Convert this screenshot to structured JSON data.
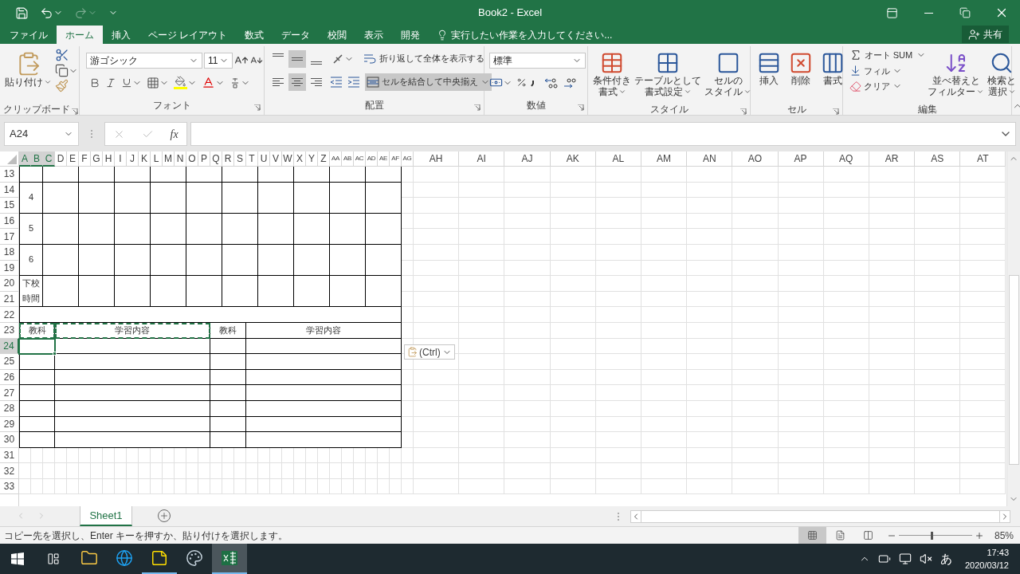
{
  "window": {
    "title": "Book2 - Excel"
  },
  "ribbon_tabs": [
    {
      "label": "ファイル",
      "selected": false
    },
    {
      "label": "ホーム",
      "selected": true
    },
    {
      "label": "挿入",
      "selected": false
    },
    {
      "label": "ページ レイアウト",
      "selected": false
    },
    {
      "label": "数式",
      "selected": false
    },
    {
      "label": "データ",
      "selected": false
    },
    {
      "label": "校閲",
      "selected": false
    },
    {
      "label": "表示",
      "selected": false
    },
    {
      "label": "開発",
      "selected": false
    }
  ],
  "tell_me": {
    "placeholder": "実行したい作業を入力してください..."
  },
  "share_button": "共有",
  "clipboard": {
    "paste_button": "貼り付け",
    "group_label": "クリップボード"
  },
  "font": {
    "name": "游ゴシック",
    "size": "11",
    "group_label": "フォント"
  },
  "alignment": {
    "vertical": [
      {
        "selected": false
      },
      {
        "selected": true
      },
      {
        "selected": false
      }
    ],
    "horizontal": [
      {
        "selected": false
      },
      {
        "selected": true
      },
      {
        "selected": false
      }
    ],
    "wrap_button": {
      "label": "折り返して全体を表示する",
      "selected": false
    },
    "merge_button": {
      "label": "セルを結合して中央揃え",
      "selected": true
    },
    "group_label": "配置"
  },
  "number": {
    "format": "標準",
    "group_label": "数値"
  },
  "styles": {
    "buttons": [
      {
        "lines": [
          "条件付き",
          "書式"
        ]
      },
      {
        "lines": [
          "テーブルとして",
          "書式設定"
        ]
      },
      {
        "lines": [
          "セルの",
          "スタイル"
        ]
      }
    ],
    "group_label": "スタイル"
  },
  "cells": {
    "buttons": [
      "挿入",
      "削除",
      "書式"
    ],
    "group_label": "セル"
  },
  "editing": {
    "autosum": "オート SUM",
    "fill": "フィル",
    "clear": "クリア",
    "sort_button": {
      "lines": [
        "並べ替えと",
        "フィルター"
      ]
    },
    "find_button": {
      "lines": [
        "検索と",
        "選択"
      ]
    },
    "group_label": "編集"
  },
  "formula_bar": {
    "name_box": "A24",
    "function_label": "fx"
  },
  "sheet": {
    "columns": [
      {
        "label": "A",
        "selected": true
      },
      {
        "label": "B",
        "selected": true
      },
      {
        "label": "C",
        "selected": true
      },
      {
        "label": "D",
        "selected": false
      },
      {
        "label": "E",
        "selected": false
      },
      {
        "label": "F",
        "selected": false
      },
      {
        "label": "G",
        "selected": false
      },
      {
        "label": "H",
        "selected": false
      },
      {
        "label": "I",
        "selected": false
      },
      {
        "label": "J",
        "selected": false
      },
      {
        "label": "K",
        "selected": false
      },
      {
        "label": "L",
        "selected": false
      },
      {
        "label": "M",
        "selected": false
      },
      {
        "label": "N",
        "selected": false
      },
      {
        "label": "O",
        "selected": false
      },
      {
        "label": "P",
        "selected": false
      },
      {
        "label": "Q",
        "selected": false
      },
      {
        "label": "R",
        "selected": false
      },
      {
        "label": "S",
        "selected": false
      },
      {
        "label": "T",
        "selected": false
      },
      {
        "label": "U",
        "selected": false
      },
      {
        "label": "V",
        "selected": false
      },
      {
        "label": "W",
        "selected": false
      },
      {
        "label": "X",
        "selected": false
      },
      {
        "label": "Y",
        "selected": false
      },
      {
        "label": "Z",
        "selected": false
      },
      {
        "label": "AA",
        "selected": false
      },
      {
        "label": "AB",
        "selected": false
      },
      {
        "label": "AC",
        "selected": false
      },
      {
        "label": "AD",
        "selected": false
      },
      {
        "label": "AE",
        "selected": false
      },
      {
        "label": "AF",
        "selected": false
      },
      {
        "label": "AG",
        "selected": false
      },
      {
        "label": "AH",
        "selected": false
      },
      {
        "label": "AI",
        "selected": false
      },
      {
        "label": "AJ",
        "selected": false
      },
      {
        "label": "AK",
        "selected": false
      },
      {
        "label": "AL",
        "selected": false
      },
      {
        "label": "AM",
        "selected": false
      },
      {
        "label": "AN",
        "selected": false
      },
      {
        "label": "AO",
        "selected": false
      },
      {
        "label": "AP",
        "selected": false
      },
      {
        "label": "AQ",
        "selected": false
      },
      {
        "label": "AR",
        "selected": false
      },
      {
        "label": "AS",
        "selected": false
      },
      {
        "label": "AT",
        "selected": false
      }
    ],
    "rows": [
      {
        "label": "13",
        "selected": false
      },
      {
        "label": "14",
        "selected": false
      },
      {
        "label": "15",
        "selected": false
      },
      {
        "label": "16",
        "selected": false
      },
      {
        "label": "17",
        "selected": false
      },
      {
        "label": "18",
        "selected": false
      },
      {
        "label": "19",
        "selected": false
      },
      {
        "label": "20",
        "selected": false
      },
      {
        "label": "21",
        "selected": false
      },
      {
        "label": "22",
        "selected": false
      },
      {
        "label": "23",
        "selected": false
      },
      {
        "label": "24",
        "selected": true
      },
      {
        "label": "25",
        "selected": false
      },
      {
        "label": "26",
        "selected": false
      },
      {
        "label": "27",
        "selected": false
      },
      {
        "label": "28",
        "selected": false
      },
      {
        "label": "29",
        "selected": false
      },
      {
        "label": "30",
        "selected": false
      },
      {
        "label": "31",
        "selected": false
      },
      {
        "label": "32",
        "selected": false
      },
      {
        "label": "33",
        "selected": false
      }
    ],
    "periods": [
      {
        "lines": [
          "4"
        ]
      },
      {
        "lines": [
          "5"
        ]
      },
      {
        "lines": [
          "6"
        ]
      },
      {
        "lines": [
          "下校",
          "時間"
        ]
      }
    ],
    "note_headers": [
      {
        "label": "教科",
        "copied": true
      },
      {
        "label": "学習内容",
        "copied": true
      },
      {
        "label": "教科",
        "copied": false
      },
      {
        "label": "学習内容",
        "copied": false
      }
    ]
  },
  "paste_options": "(Ctrl)",
  "sheet_tabs": [
    {
      "label": "Sheet1",
      "selected": true
    }
  ],
  "status_bar": {
    "message": "コピー先を選択し、Enter キーを押すか、貼り付けを選択します。",
    "views": [
      {
        "selected": true
      },
      {
        "selected": false
      },
      {
        "selected": false
      }
    ],
    "zoom": {
      "level": 0.43,
      "reading": "85%"
    }
  },
  "taskbar": {
    "apps": [
      {
        "kind": "explorer",
        "running": false,
        "selected": false
      },
      {
        "kind": "browser",
        "running": false,
        "selected": false
      },
      {
        "kind": "notes",
        "running": true,
        "selected": false
      },
      {
        "kind": "paint",
        "running": false,
        "selected": false
      },
      {
        "kind": "excel",
        "running": true,
        "selected": true
      }
    ],
    "ime": "あ",
    "time": "17:43",
    "date": "2020/03/12"
  }
}
